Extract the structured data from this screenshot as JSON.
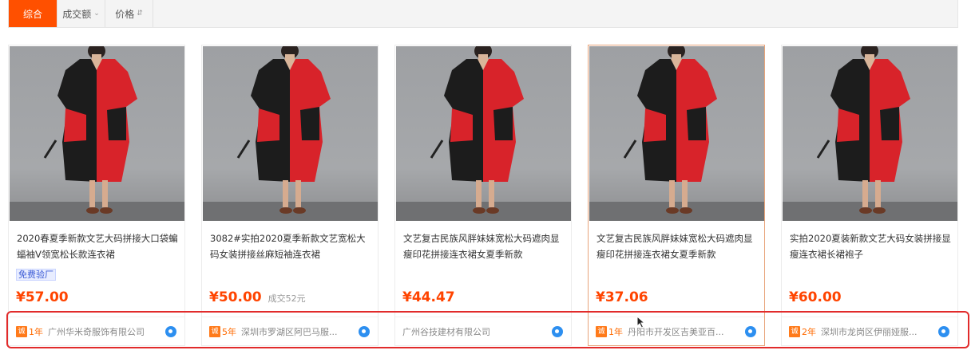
{
  "sortbar": {
    "items": [
      {
        "label": "综合",
        "active": true
      },
      {
        "label": "成交额",
        "active": false,
        "arrow": "chevron-down-icon"
      },
      {
        "label": "价格",
        "active": false,
        "arrow": "sort-updown-icon"
      }
    ]
  },
  "products": [
    {
      "title": "2020春夏季新款文艺大码拼接大口袋蝙蝠袖V领宽松长款连衣裙",
      "tag": "免费验厂",
      "price": "¥57.00",
      "deal": "",
      "badge": "诚",
      "years": "1年",
      "company": "广州华米奇服饰有限公司"
    },
    {
      "title": "3082#实拍2020夏季新款文艺宽松大码女装拼接丝麻短袖连衣裙",
      "tag": "",
      "price": "¥50.00",
      "deal": "成交52元",
      "badge": "诚",
      "years": "5年",
      "company": "深圳市罗湖区阿巴马服..."
    },
    {
      "title": "文艺复古民族风胖妹妹宽松大码遮肉显瘦印花拼接连衣裙女夏季新款",
      "tag": "",
      "price": "¥44.47",
      "deal": "",
      "badge": "",
      "years": "",
      "company": "广州谷技建材有限公司"
    },
    {
      "title": "文艺复古民族风胖妹妹宽松大码遮肉显瘦印花拼接连衣裙女夏季新款",
      "tag": "",
      "price": "¥37.06",
      "deal": "",
      "badge": "诚",
      "years": "1年",
      "company": "丹阳市开发区吉美亚百..."
    },
    {
      "title": "实拍2020夏装新款文艺大码女装拼接显瘦连衣裙长裙袍子",
      "tag": "",
      "price": "¥60.00",
      "deal": "",
      "badge": "诚",
      "years": "2年",
      "company": "深圳市龙岗区伊丽娅服..."
    }
  ],
  "colors": {
    "accent": "#ff5000",
    "price": "#ff4400",
    "highlight": "#e12b2b",
    "dress_red": "#d8232a",
    "dress_black": "#1c1c1c"
  }
}
